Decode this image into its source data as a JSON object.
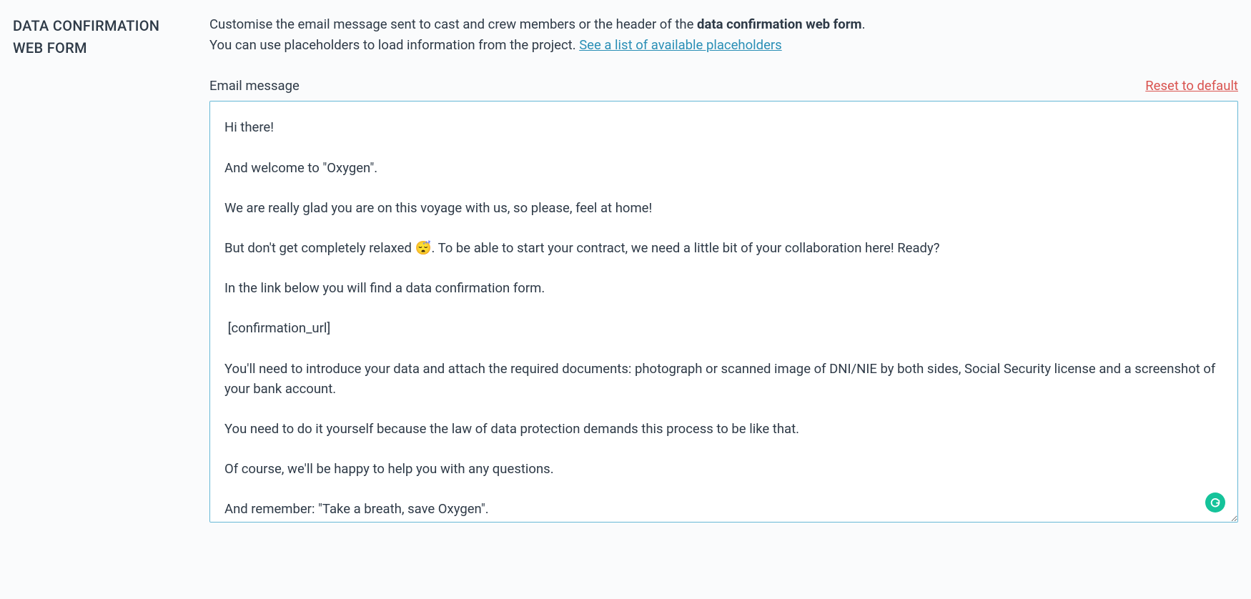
{
  "section": {
    "title": "DATA CONFIRMATION WEB FORM"
  },
  "description": {
    "line1_prefix": "Customise the email message sent to cast and crew members or the header of the ",
    "line1_bold": "data confirmation web form",
    "line1_suffix": ".",
    "line2_prefix": "You can use placeholders to load information from the project. ",
    "line2_link": "See a list of available placeholders"
  },
  "field": {
    "label": "Email message",
    "reset_label": "Reset to default"
  },
  "editor": {
    "content": "Hi there!\n\nAnd welcome to \"Oxygen\".\n\nWe are really glad you are on this voyage with us, so please, feel at home!\n\nBut don't get completely relaxed 😴. To be able to start your contract, we need a little bit of your collaboration here! Ready?\n\nIn the link below you will find a data confirmation form.\n\n [confirmation_url]\n\nYou'll need to introduce your data and attach the required documents: photograph or scanned image of DNI/NIE by both sides, Social Security license and a screenshot of your bank account.\n\nYou need to do it yourself because the law of data protection demands this process to be like that.\n\nOf course, we'll be happy to help you with any questions.\n\nAnd remember: \"Take a breath, save Oxygen\"."
  }
}
